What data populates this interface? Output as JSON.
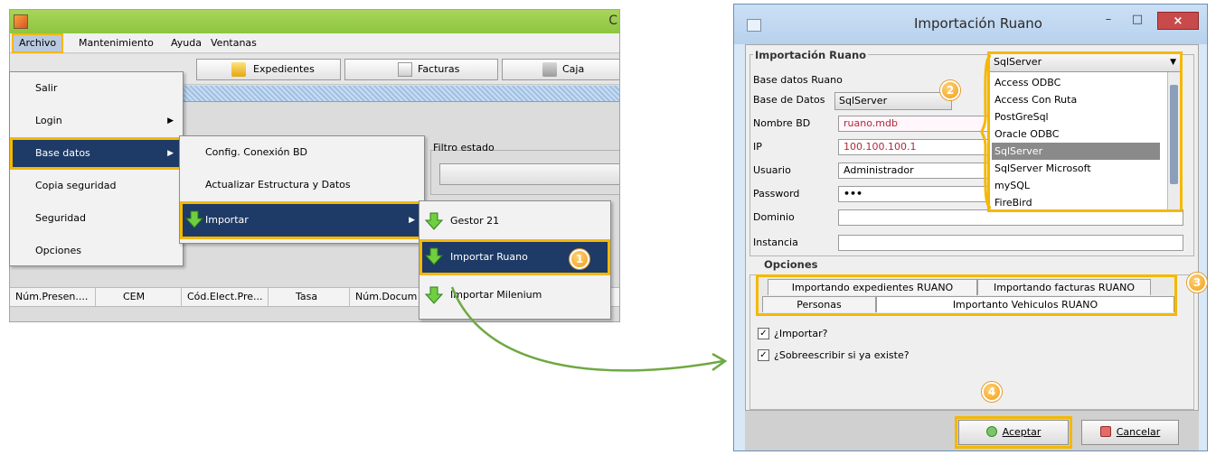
{
  "left_window": {
    "title_fragment": "C",
    "menubar": [
      "Archivo",
      "Mantenimiento",
      "Ayuda",
      "Ventanas"
    ],
    "toolbar": {
      "expedientes": "Expedientes",
      "facturas": "Facturas",
      "caja": "Caja"
    },
    "filter_legend": "Filtro estado",
    "columns": [
      "Núm.Presen....",
      "CEM",
      "Cód.Elect.Pre...",
      "Tasa",
      "Núm.Docum"
    ],
    "archivo_menu": [
      "Salir",
      "Login",
      "Base datos",
      "Copia seguridad",
      "Seguridad",
      "Opciones"
    ],
    "base_datos_menu": [
      "Config. Conexión BD",
      "Actualizar Estructura y Datos",
      "Importar"
    ],
    "importar_menu": [
      "Gestor 21",
      "Importar Ruano",
      "Importar Milenium"
    ]
  },
  "dialog": {
    "title": "Importación Ruano",
    "group_title": "Importación Ruano",
    "base_datos_ruano_label": "Base datos Ruano",
    "base_de_datos_label": "Base de Datos",
    "base_de_datos_value": "SqlServer",
    "nombre_bd_label": "Nombre BD",
    "nombre_bd_value": "ruano.mdb",
    "ip_label": "IP",
    "ip_value": "100.100.100.1",
    "usuario_label": "Usuario",
    "usuario_value": "Administrador",
    "password_label": "Password",
    "password_value": "•••",
    "dominio_label": "Dominio",
    "instancia_label": "Instancia",
    "db_list_selected": "SqlServer",
    "db_options": [
      "Access ODBC",
      "Access Con Ruta",
      "PostGreSql",
      "Oracle ODBC",
      "SqlServer",
      "SqlServer Microsoft",
      "mySQL",
      "FireBird"
    ],
    "opciones_label": "Opciones",
    "tabs_row1": [
      "Importando expedientes RUANO",
      "Importando facturas RUANO"
    ],
    "tabs_row2": [
      "Personas",
      "Importanto Vehiculos RUANO"
    ],
    "check_importar": "¿Importar?",
    "check_sobreescribir": "¿Sobreescribir si ya existe?",
    "aceptar": "Aceptar",
    "cancelar": "Cancelar",
    "close_glyph": "×",
    "minimize_glyph": "–",
    "maximize_glyph": "□"
  },
  "badges": [
    "1",
    "2",
    "3",
    "4"
  ],
  "colors": {
    "highlight": "#f5b800",
    "menu_selected": "#1e3a66",
    "arrow": "#6ea843",
    "badge": "#f29d14"
  }
}
